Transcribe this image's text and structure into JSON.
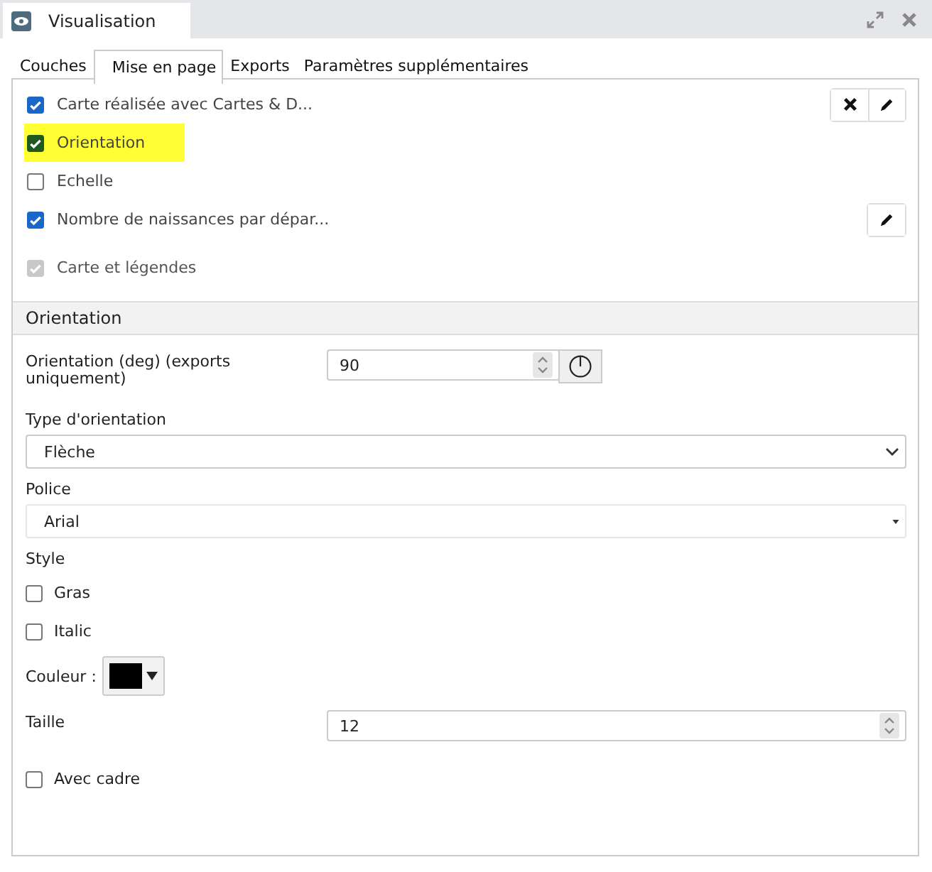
{
  "window": {
    "title": "Visualisation"
  },
  "tabs": [
    {
      "label": "Couches",
      "selected": false
    },
    {
      "label": "Mise en page",
      "selected": true
    },
    {
      "label": "Exports",
      "selected": false
    },
    {
      "label": "Paramètres supplémentaires",
      "selected": false
    }
  ],
  "layers": [
    {
      "label": "Carte réalisée avec Cartes & D...",
      "checked": true,
      "highlighted": false,
      "disabled": false,
      "delete": true,
      "edit": true
    },
    {
      "label": "Orientation",
      "checked": true,
      "highlighted": true,
      "disabled": false,
      "delete": false,
      "edit": false
    },
    {
      "label": "Echelle",
      "checked": false,
      "highlighted": false,
      "disabled": false,
      "delete": false,
      "edit": false
    },
    {
      "label": "Nombre de naissances par dépar...",
      "checked": true,
      "highlighted": false,
      "disabled": false,
      "delete": false,
      "edit": true
    },
    {
      "label": "Carte et légendes",
      "checked": true,
      "highlighted": false,
      "disabled": true,
      "delete": false,
      "edit": false
    }
  ],
  "section": {
    "title": "Orientation"
  },
  "orientation": {
    "label": "Orientation (deg) (exports uniquement)",
    "value": "90"
  },
  "orientation_type": {
    "label": "Type d'orientation",
    "value": "Flèche"
  },
  "font": {
    "label": "Police",
    "value": "Arial"
  },
  "style": {
    "label": "Style",
    "options": [
      {
        "label": "Gras",
        "checked": false
      },
      {
        "label": "Italic",
        "checked": false
      }
    ]
  },
  "colour": {
    "label": "Couleur :",
    "color": "#000000"
  },
  "size": {
    "label": "Taille",
    "value": "12"
  },
  "frame": {
    "label": "Avec cadre",
    "checked": false
  }
}
